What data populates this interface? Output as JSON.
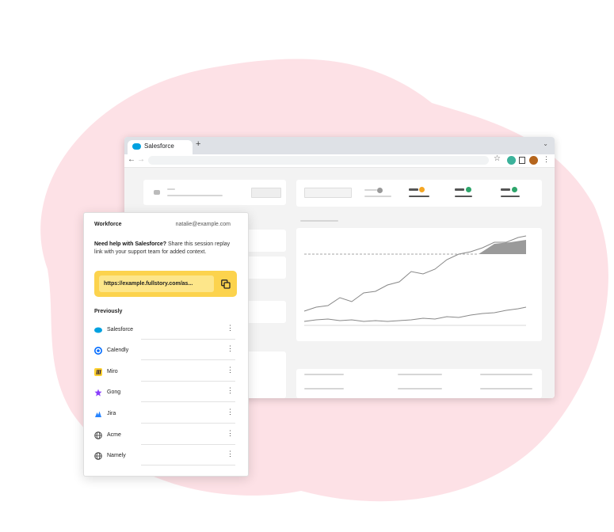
{
  "browser": {
    "tab_title": "Salesforce",
    "new_tab": "+",
    "tab_chevron": "⌄",
    "nav_back": "←",
    "nav_forward": "→",
    "bookmark_icon": "☆",
    "menu_icon": "⋮"
  },
  "panel": {
    "workspace": "Workforce",
    "email": "natalie@example.com",
    "help_title": "Need help with Salesforce?",
    "help_body": " Share this session replay link with your support team for added context.",
    "link": "https://example.fullstory.com/as...",
    "previously_label": "Previously",
    "apps": [
      {
        "label": "Salesforce",
        "icon": "salesforce-icon",
        "color": "#00a1e0"
      },
      {
        "label": "Calendly",
        "icon": "calendly-icon",
        "color": "#006bff"
      },
      {
        "label": "Miro",
        "icon": "miro-icon",
        "color": "#ffd02f"
      },
      {
        "label": "Gong",
        "icon": "gong-icon",
        "color": "#8a3ffc"
      },
      {
        "label": "Jira",
        "icon": "jira-icon",
        "color": "#2684ff"
      },
      {
        "label": "Acme",
        "icon": "globe-icon",
        "color": "#444444"
      },
      {
        "label": "Namely",
        "icon": "globe-icon",
        "color": "#444444"
      }
    ],
    "more_icon": "⋮"
  },
  "colors": {
    "accent": "#fcd34d",
    "blob": "#fde1e6"
  }
}
